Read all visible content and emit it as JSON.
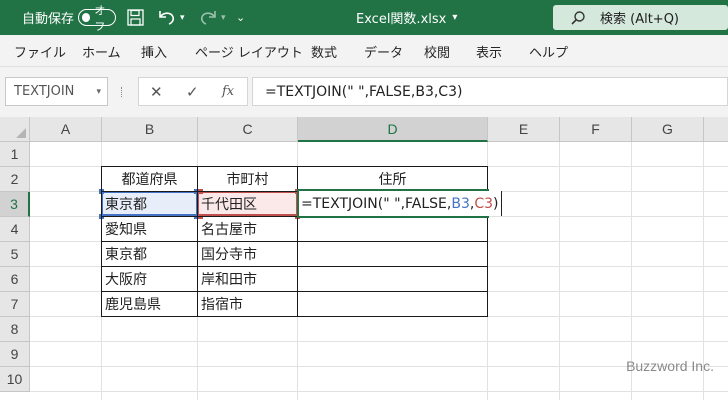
{
  "titlebar": {
    "autosave_label": "自動保存",
    "autosave_state": "オフ",
    "filename": "Excel関数.xlsx",
    "filename_caret": "▾",
    "qat_customize": "⌄",
    "search_text": "検索 (Alt+Q)",
    "bg_color": "#217346"
  },
  "ribbon": {
    "tabs": [
      "ファイル",
      "ホーム",
      "挿入",
      "ページ レイアウト",
      "数式",
      "データ",
      "校閲",
      "表示",
      "ヘルプ"
    ]
  },
  "formula_bar": {
    "name_box": "TEXTJOIN",
    "cancel": "✕",
    "enter": "✓",
    "fx": "fx",
    "formula": "=TEXTJOIN(\" \",FALSE,B3,C3)"
  },
  "sheet": {
    "columns": [
      "A",
      "B",
      "C",
      "D",
      "E",
      "F",
      "G"
    ],
    "rows": [
      "1",
      "2",
      "3",
      "4",
      "5",
      "6",
      "7",
      "8",
      "9",
      "10"
    ],
    "headers": {
      "B2": "都道府県",
      "C2": "市町村",
      "D2": "住所"
    },
    "cells": {
      "B3": "東京都",
      "C3": "千代田区",
      "B4": "愛知県",
      "C4": "名古屋市",
      "B5": "東京都",
      "C5": "国分寺市",
      "B6": "大阪府",
      "C6": "岸和田市",
      "B7": "鹿児島県",
      "C7": "指宿市"
    },
    "editing": {
      "cell": "D3",
      "prefix": "=TEXTJOIN(\" \",FALSE,",
      "ref1": "B3",
      "comma": ",",
      "ref2": "C3",
      "suffix": ")",
      "ref1_color": "#4472c4",
      "ref2_color": "#c0504d"
    },
    "selected_column": "D",
    "selected_row": "3"
  },
  "watermark": "Buzzword Inc."
}
